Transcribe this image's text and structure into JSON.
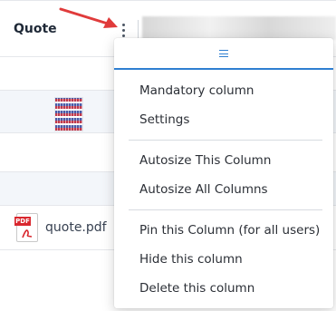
{
  "header": {
    "column_title": "Quote",
    "kebab_icon": "vertical-ellipsis-icon"
  },
  "rows": [
    {
      "type": "empty"
    },
    {
      "type": "image-thumbnail",
      "icon": "qr-thumbnail-icon"
    },
    {
      "type": "empty"
    },
    {
      "type": "empty"
    },
    {
      "type": "file",
      "icon": "pdf-file-icon",
      "file_name": "quote.pdf"
    },
    {
      "type": "empty"
    }
  ],
  "annotation": {
    "arrow_icon": "red-arrow-icon",
    "arrow_color": "#e03b3b"
  },
  "menu": {
    "header_icon": "hamburger-menu-icon",
    "accent_color": "#2f7fd1",
    "groups": [
      [
        "Mandatory column",
        "Settings"
      ],
      [
        "Autosize This Column",
        "Autosize All Columns"
      ],
      [
        "Pin this Column (for all users)",
        "Hide this column",
        "Delete this column"
      ]
    ]
  }
}
